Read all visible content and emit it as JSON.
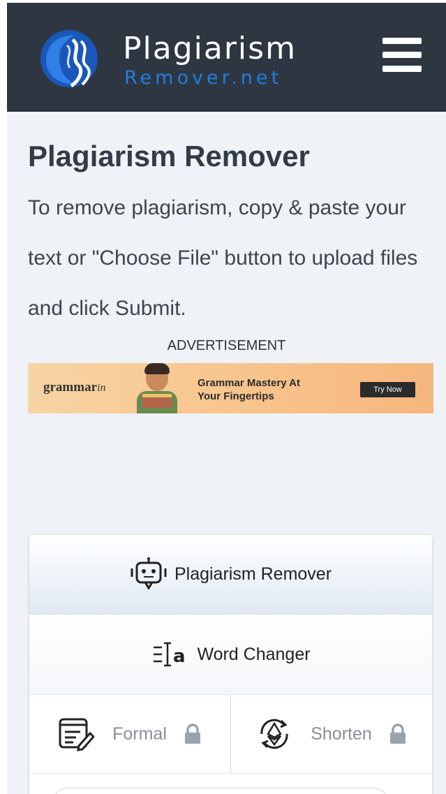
{
  "header": {
    "logo_title": "Plagiarism",
    "logo_subtitle": "Remover.net",
    "logo_icon": "swirl-logo-icon",
    "menu_icon": "hamburger-menu-icon",
    "background": "#2e3642",
    "accent": "#1e7fe0"
  },
  "main": {
    "title": "Plagiarism Remover",
    "description": "To remove plagiarism, copy & paste your text or \"Choose File\" button to upload files and click Submit."
  },
  "ad": {
    "label": "ADVERTISEMENT",
    "brand_main": "grammar",
    "brand_suffix": "in",
    "headline_1": "Grammar Mastery At",
    "headline_2": "Your Fingertips",
    "cta": "Try Now"
  },
  "tool_card": {
    "tabs": [
      {
        "label": "Plagiarism Remover",
        "icon": "robot-icon",
        "active": true
      },
      {
        "label": "Word Changer",
        "icon": "word-changer-icon",
        "active": false
      }
    ],
    "modes": [
      {
        "label": "Formal",
        "icon": "document-edit-icon",
        "locked": true
      },
      {
        "label": "Shorten",
        "icon": "ethereum-cycle-icon",
        "locked": true
      }
    ]
  }
}
